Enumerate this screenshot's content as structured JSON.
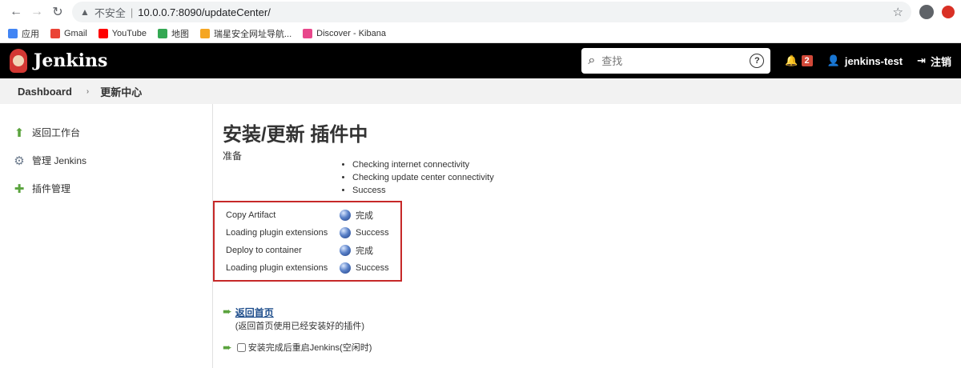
{
  "browser": {
    "insecure_label": "不安全",
    "url": "10.0.0.7:8090/updateCenter/",
    "bookmarks": [
      {
        "label": "应用",
        "color": "#4285f4"
      },
      {
        "label": "Gmail",
        "color": "#ea4335"
      },
      {
        "label": "YouTube",
        "color": "#ff0000"
      },
      {
        "label": "地图",
        "color": "#34a853"
      },
      {
        "label": "瑞星安全网址导航...",
        "color": "#f5a623"
      },
      {
        "label": "Discover - Kibana",
        "color": "#e8478b"
      }
    ]
  },
  "header": {
    "title": "Jenkins",
    "search_placeholder": "查找",
    "help": "?",
    "notifications_count": "2",
    "username": "jenkins-test",
    "logout": "注销"
  },
  "breadcrumb": {
    "items": [
      "Dashboard",
      "更新中心"
    ]
  },
  "sidebar": {
    "items": [
      {
        "label": "返回工作台",
        "icon": "up-arrow-icon"
      },
      {
        "label": "管理 Jenkins",
        "icon": "gear-icon"
      },
      {
        "label": "插件管理",
        "icon": "puzzle-icon"
      }
    ]
  },
  "main": {
    "title": "安装/更新 插件中",
    "prep_label": "准备",
    "checks": [
      "Checking internet connectivity",
      "Checking update center connectivity",
      "Success"
    ],
    "plugins": [
      {
        "name": "Copy Artifact",
        "status": "完成"
      },
      {
        "name": "Loading plugin extensions",
        "status": "Success"
      },
      {
        "name": "Deploy to container",
        "status": "完成"
      },
      {
        "name": "Loading plugin extensions",
        "status": "Success"
      }
    ],
    "back_link": "返回首页",
    "back_note": "(返回首页使用已经安装好的插件)",
    "restart_label": "安装完成后重启Jenkins(空闲时)"
  },
  "colors": {
    "header_bg": "#000000",
    "highlight_border": "#c62828",
    "badge": "#d24939",
    "link": "#1f4e8c"
  }
}
